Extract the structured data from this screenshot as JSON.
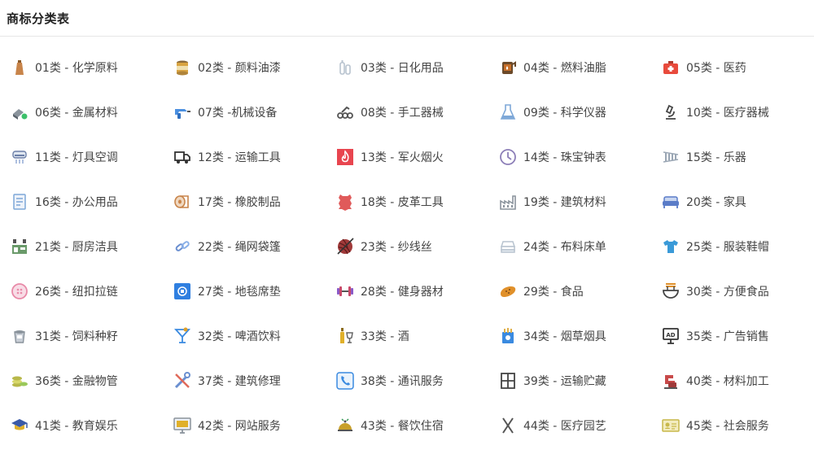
{
  "header": {
    "title": "商标分类表"
  },
  "items": [
    {
      "label": "01类 - 化学原料",
      "icon": "flask-bottle-icon",
      "color": "#c8844a"
    },
    {
      "label": "02类 - 颜料油漆",
      "icon": "paint-can-icon",
      "color": "#d9a441"
    },
    {
      "label": "03类 - 日化用品",
      "icon": "cosmetics-icon",
      "color": "#b8c3cf"
    },
    {
      "label": "04类 - 燃料油脂",
      "icon": "oil-barrel-icon",
      "color": "#c8702a"
    },
    {
      "label": "05类 - 医药",
      "icon": "first-aid-kit-icon",
      "color": "#e84a3c"
    },
    {
      "label": "06类 - 金属材料",
      "icon": "metal-material-icon",
      "color": "#8a939c"
    },
    {
      "label": "07类 -机械设备",
      "icon": "drill-icon",
      "color": "#4a8fe0"
    },
    {
      "label": "08类 - 手工器械",
      "icon": "hand-tool-icon",
      "color": "#555555"
    },
    {
      "label": "09类 - 科学仪器",
      "icon": "beaker-icon",
      "color": "#7ea8d8"
    },
    {
      "label": "10类 - 医疗器械",
      "icon": "microscope-icon",
      "color": "#444444"
    },
    {
      "label": "11类 - 灯具空调",
      "icon": "air-conditioner-icon",
      "color": "#6b7fa8"
    },
    {
      "label": "12类 - 运输工具",
      "icon": "truck-icon",
      "color": "#333333"
    },
    {
      "label": "13类 - 军火烟火",
      "icon": "fire-icon",
      "color": "#e8454f"
    },
    {
      "label": "14类 - 珠宝钟表",
      "icon": "clock-icon",
      "color": "#8d7fb8"
    },
    {
      "label": "15类 - 乐器",
      "icon": "xylophone-icon",
      "color": "#9aa6b4"
    },
    {
      "label": "16类 - 办公用品",
      "icon": "document-icon",
      "color": "#7ea8d8"
    },
    {
      "label": "17类 - 橡胶制品",
      "icon": "rubber-roll-icon",
      "color": "#c8844a"
    },
    {
      "label": "18类 - 皮革工具",
      "icon": "leather-icon",
      "color": "#e05a5a"
    },
    {
      "label": "19类 - 建筑材料",
      "icon": "factory-icon",
      "color": "#8a939c"
    },
    {
      "label": "20类 - 家具",
      "icon": "sofa-icon",
      "color": "#5a7cc8"
    },
    {
      "label": "21类 - 厨房洁具",
      "icon": "kitchen-icon",
      "color": "#5a8a5a"
    },
    {
      "label": "22类 - 绳网袋篷",
      "icon": "chain-icon",
      "color": "#6a8fd0"
    },
    {
      "label": "23类 - 纱线丝",
      "icon": "yarn-ball-icon",
      "color": "#a03a3a"
    },
    {
      "label": "24类 - 布料床单",
      "icon": "folded-cloth-icon",
      "color": "#b8c3cf"
    },
    {
      "label": "25类 - 服装鞋帽",
      "icon": "tshirt-icon",
      "color": "#3a9ad8"
    },
    {
      "label": "26类 - 纽扣拉链",
      "icon": "button-icon",
      "color": "#e88aa8"
    },
    {
      "label": "27类 - 地毯席垫",
      "icon": "rug-icon",
      "color": "#2f7fe0"
    },
    {
      "label": "28类 - 健身器材",
      "icon": "dumbbell-icon",
      "color": "#8a5ac8"
    },
    {
      "label": "29类 - 食品",
      "icon": "bread-icon",
      "color": "#e0902a"
    },
    {
      "label": "30类 - 方便食品",
      "icon": "noodle-bowl-icon",
      "color": "#444444"
    },
    {
      "label": "31类 - 饲料种籽",
      "icon": "feed-bucket-icon",
      "color": "#8a939c"
    },
    {
      "label": "32类 - 啤酒饮料",
      "icon": "cocktail-icon",
      "color": "#e0a02a"
    },
    {
      "label": "33类 - 酒",
      "icon": "wine-bottle-icon",
      "color": "#e0b02a"
    },
    {
      "label": "34类 - 烟草烟具",
      "icon": "cigarette-box-icon",
      "color": "#3a8ae0"
    },
    {
      "label": "35类 - 广告销售",
      "icon": "ad-board-icon",
      "color": "#333333"
    },
    {
      "label": "36类 - 金融物管",
      "icon": "coins-icon",
      "color": "#b8b84a"
    },
    {
      "label": "37类 - 建筑修理",
      "icon": "tools-icon",
      "color": "#6a8fd0"
    },
    {
      "label": "38类 - 通讯服务",
      "icon": "phone-icon",
      "color": "#3a8ae0"
    },
    {
      "label": "39类 - 运输贮藏",
      "icon": "cabinet-icon",
      "color": "#444444"
    },
    {
      "label": "40类 - 材料加工",
      "icon": "mixer-icon",
      "color": "#c84a4a"
    },
    {
      "label": "41类 - 教育娱乐",
      "icon": "graduation-cap-icon",
      "color": "#3a5aa8"
    },
    {
      "label": "42类 - 网站服务",
      "icon": "monitor-icon",
      "color": "#8a939c"
    },
    {
      "label": "43类 - 餐饮住宿",
      "icon": "food-cloche-icon",
      "color": "#c8a02a"
    },
    {
      "label": "44类 - 医疗园艺",
      "icon": "scissors-icon",
      "color": "#555555"
    },
    {
      "label": "45类 - 社会服务",
      "icon": "id-card-icon",
      "color": "#c8b84a"
    }
  ]
}
